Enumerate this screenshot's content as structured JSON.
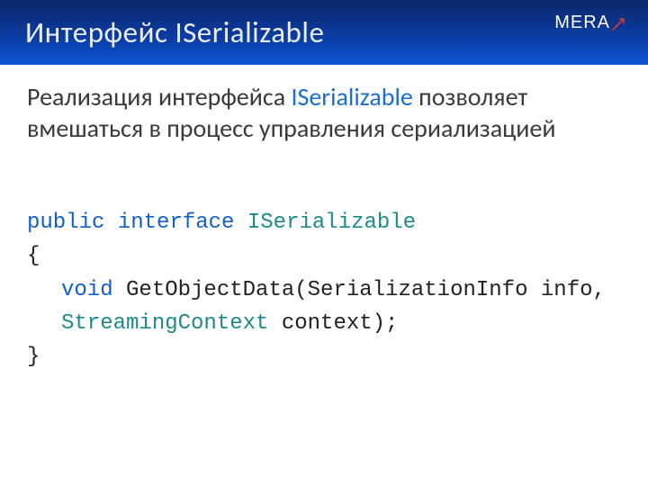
{
  "title": "Интерфейс ISerializable",
  "logo_text": "MERA",
  "desc": {
    "part1": "Реализация интерфейса ",
    "hl": "ISerializable",
    "part2": " позволяет вмешаться в процесс управления сериализацией"
  },
  "code": {
    "kw_public": "public",
    "kw_interface": "interface",
    "type_iser": "ISerializable",
    "brace_open": "{",
    "kw_void": "void",
    "method_sig": " GetObjectData(SerializationInfo info,",
    "type_sc": "StreamingContext",
    "param_tail": " context);",
    "brace_close": "}"
  }
}
